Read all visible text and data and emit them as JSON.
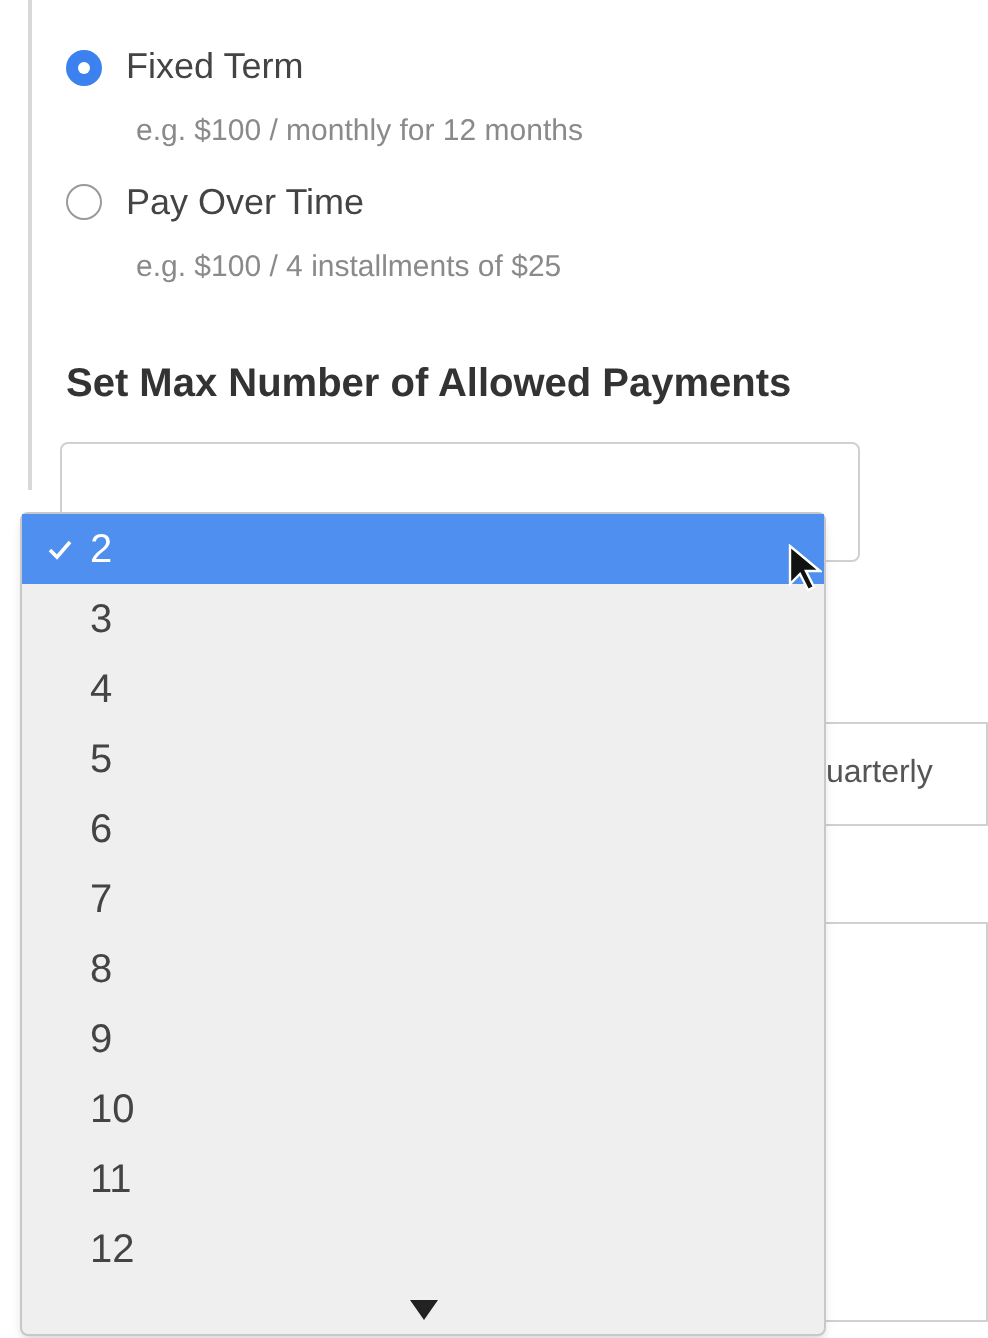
{
  "payment_types": [
    {
      "label": "Fixed Term",
      "example": "e.g. $100 / monthly for 12 months",
      "selected": true
    },
    {
      "label": "Pay Over Time",
      "example": "e.g. $100 / 4 installments of $25",
      "selected": false
    }
  ],
  "max_payments": {
    "heading": "Set Max Number of Allowed Payments",
    "options": [
      {
        "label": "2",
        "selected": true
      },
      {
        "label": "3",
        "selected": false
      },
      {
        "label": "4",
        "selected": false
      },
      {
        "label": "5",
        "selected": false
      },
      {
        "label": "6",
        "selected": false
      },
      {
        "label": "7",
        "selected": false
      },
      {
        "label": "8",
        "selected": false
      },
      {
        "label": "9",
        "selected": false
      },
      {
        "label": "10",
        "selected": false
      },
      {
        "label": "11",
        "selected": false
      },
      {
        "label": "12",
        "selected": false
      }
    ]
  },
  "frequency_field": {
    "value": "uarterly"
  }
}
